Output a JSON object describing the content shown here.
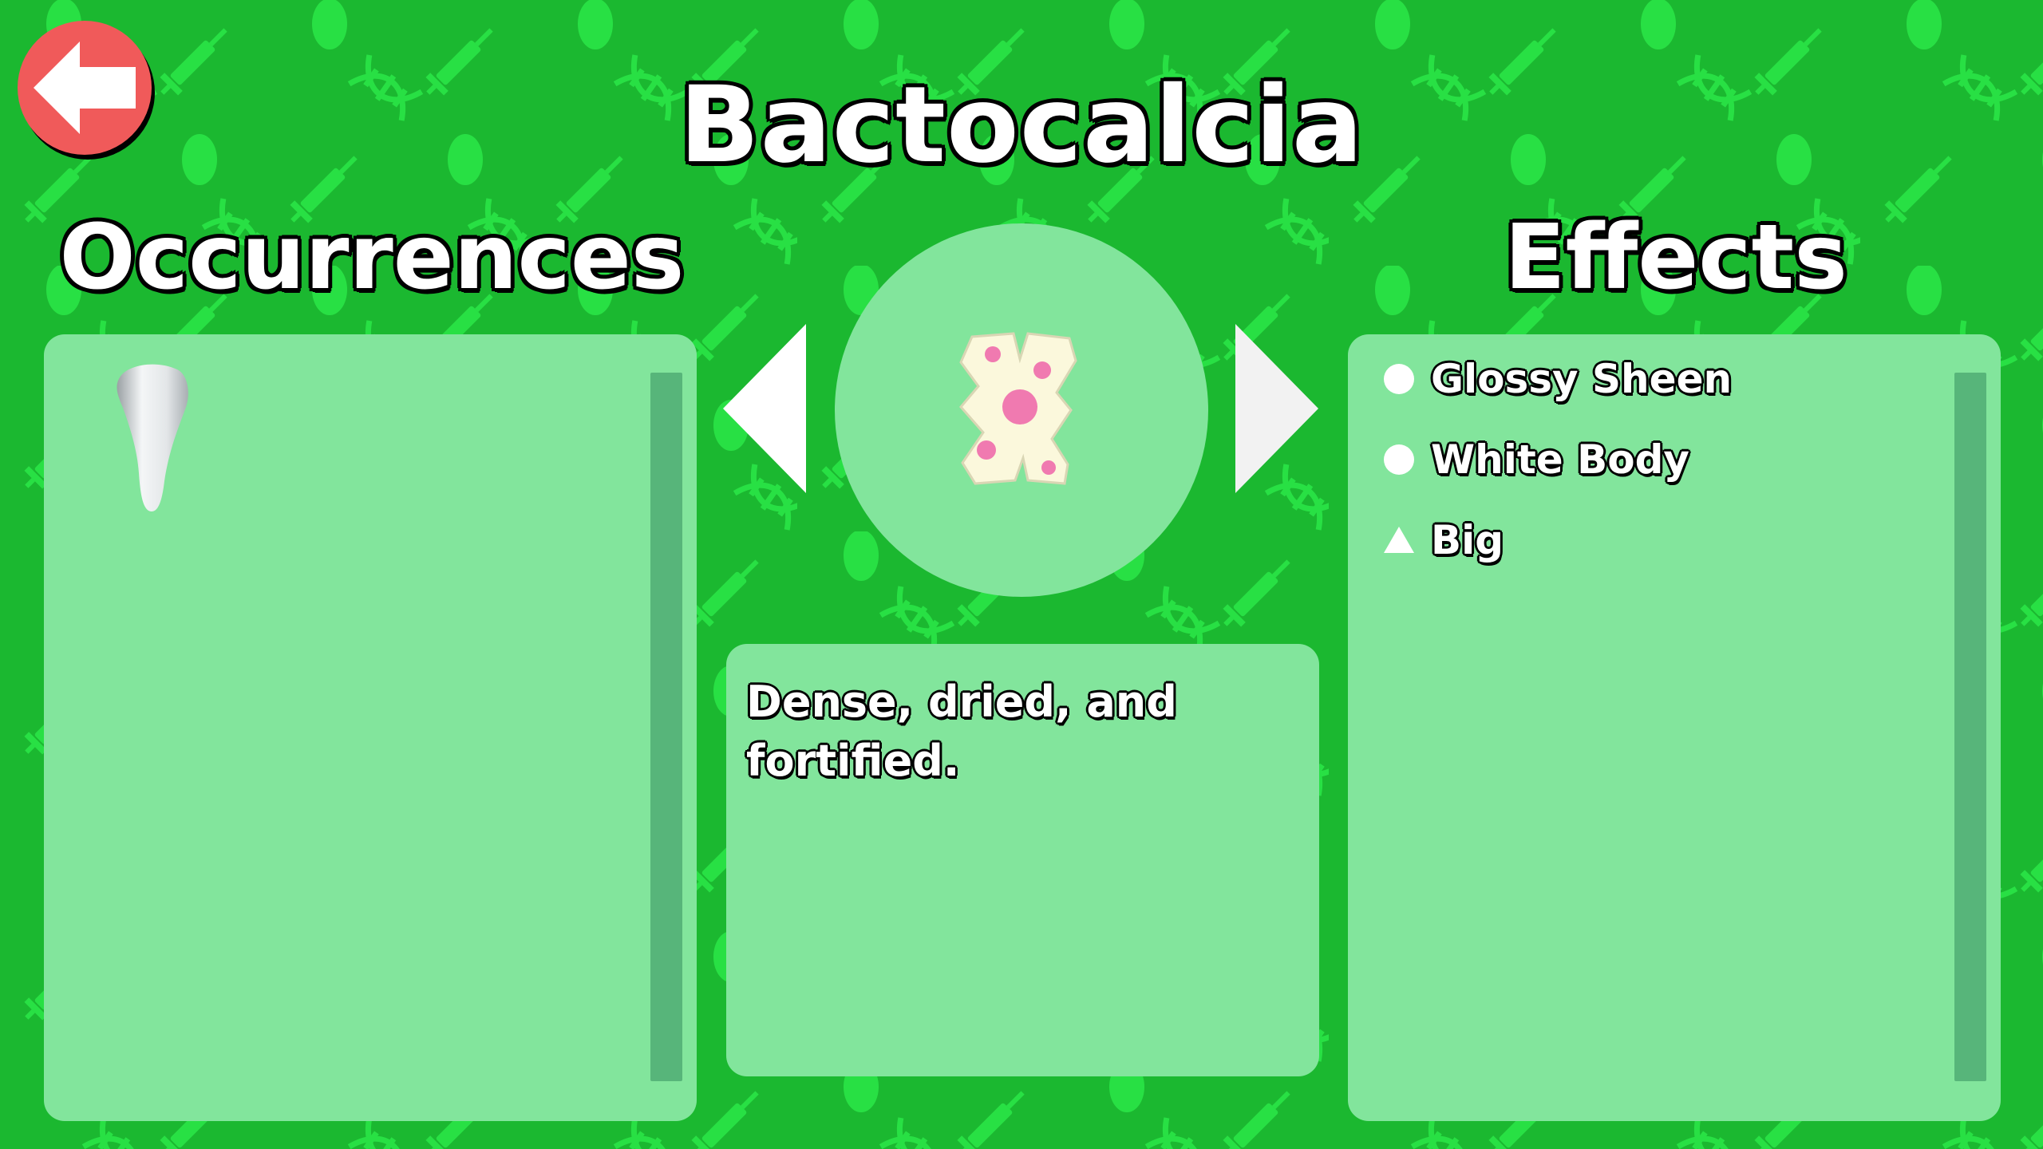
{
  "title": "Bactocalcia",
  "occurrences": {
    "heading": "Occurrences",
    "items": [
      {
        "icon": "tooth-icon"
      }
    ]
  },
  "effects": {
    "heading": "Effects",
    "items": [
      {
        "shape": "circle",
        "label": "Glossy Sheen"
      },
      {
        "shape": "circle",
        "label": "White Body"
      },
      {
        "shape": "triangle",
        "label": "Big"
      }
    ]
  },
  "description": "Dense, dried, and fortified.",
  "colors": {
    "background": "#1bb830",
    "pattern": "#28e044",
    "panel": "#82e59c",
    "scrollbar": "#57b57a",
    "back_button": "#f05a5a",
    "item_body": "#fbf8dc",
    "item_spots": "#f07ab0"
  },
  "icons": {
    "back": "back-arrow-icon",
    "previous": "previous-arrow-icon",
    "next": "next-arrow-icon",
    "item": "bactocalcia-icon"
  }
}
